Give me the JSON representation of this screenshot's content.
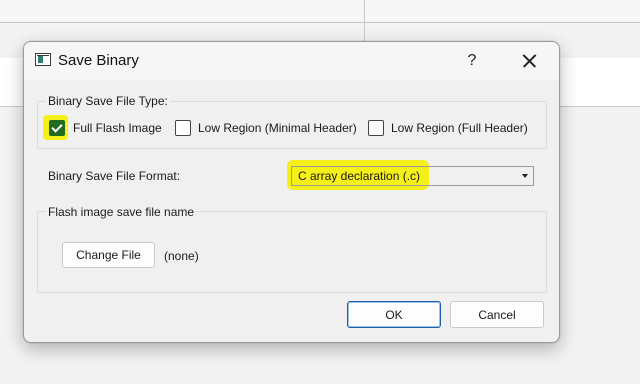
{
  "dialog": {
    "title": "Save Binary",
    "help_label": "?",
    "close_label": "Close"
  },
  "file_type": {
    "label": "Binary Save File Type:",
    "options": [
      {
        "label": "Full Flash Image",
        "checked": true
      },
      {
        "label": "Low Region (Minimal Header)",
        "checked": false
      },
      {
        "label": "Low Region (Full Header)",
        "checked": false
      }
    ]
  },
  "file_format": {
    "label": "Binary Save File Format:",
    "selected": "C array declaration (.c)"
  },
  "save_name": {
    "label": "Flash image save file name",
    "button_label": "Change File",
    "value": "(none)"
  },
  "footer": {
    "ok_label": "OK",
    "cancel_label": "Cancel"
  },
  "colors": {
    "highlight": "#f5f019",
    "checkbox_checked": "#1f6b1f",
    "primary_border": "#1f5ea8"
  }
}
